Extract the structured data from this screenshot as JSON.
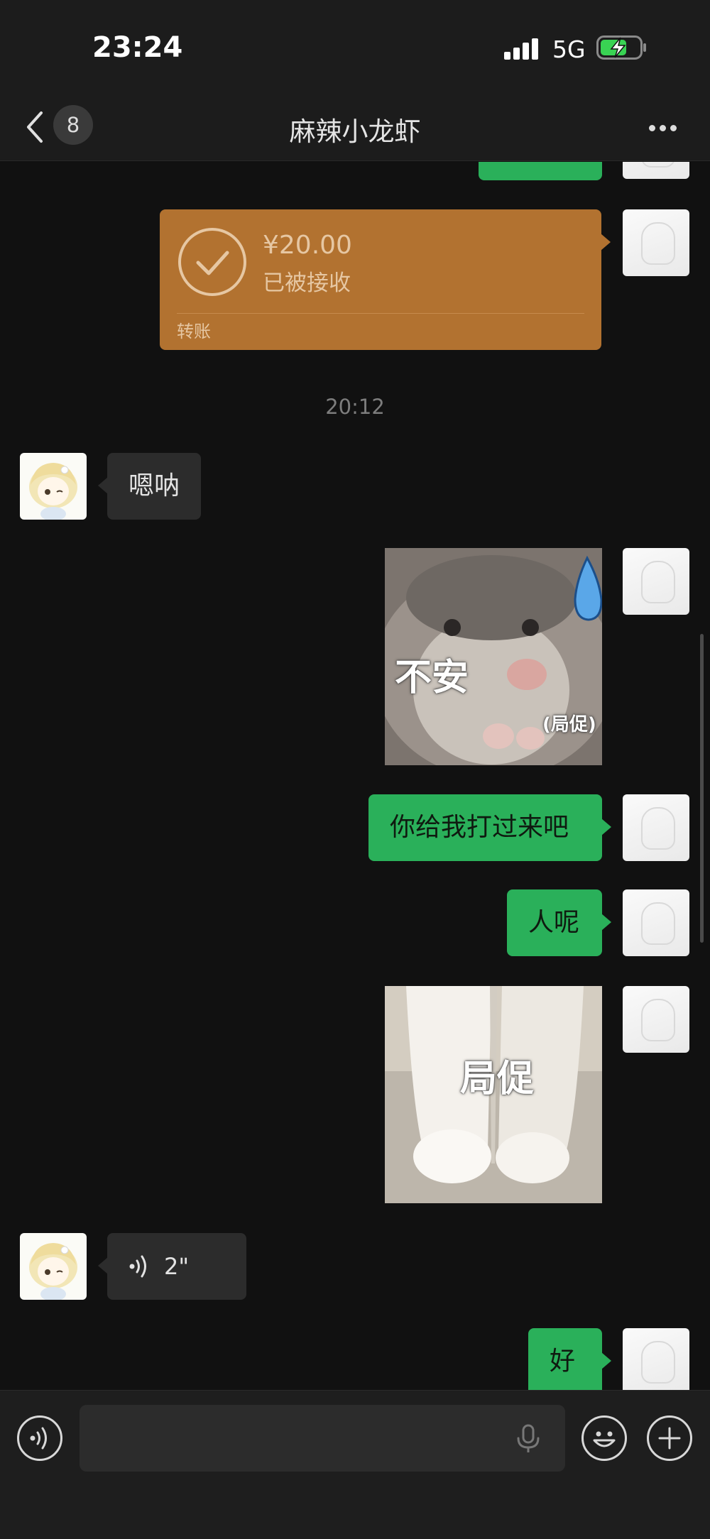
{
  "status_bar": {
    "time": "23:24",
    "network": "5G"
  },
  "header": {
    "unread_count": "8",
    "title": "麻辣小龙虾"
  },
  "messages": {
    "transfer": {
      "amount": "¥20.00",
      "status": "已被接收",
      "label": "转账"
    },
    "timestamp": "20:12",
    "reply_1": "嗯呐",
    "sticker_1": {
      "caption": "不安",
      "sub_caption": "(局促)"
    },
    "msg_2": "你给我打过来吧",
    "msg_3": "人呢",
    "sticker_2": {
      "caption": "局促"
    },
    "voice": {
      "duration": "2\""
    },
    "msg_4": "好"
  },
  "colors": {
    "sent_bubble": "#2ab05a",
    "received_bubble": "#2c2c2c",
    "transfer_card": "#b27230",
    "background": "#111111"
  },
  "icons": [
    "back-chevron-icon",
    "more-icon",
    "checkmark-icon",
    "voice-wave-icon",
    "microphone-icon",
    "emoji-icon",
    "plus-icon"
  ]
}
